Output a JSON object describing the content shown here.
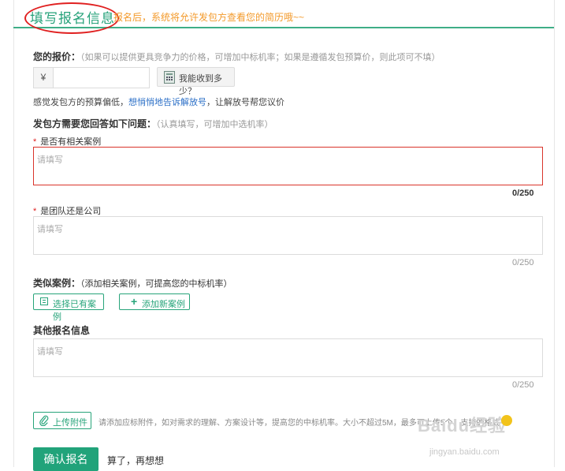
{
  "header": {
    "title": "填写报名信息",
    "notice": "报名后，系统将允许发包方查看您的简历哦~~"
  },
  "price": {
    "label": "您的报价：",
    "hint": "（如果可以提供更具竞争力的价格，可增加中标机率；如果是遵循发包预算价，则此项可不填）",
    "currency": "¥",
    "value": "",
    "calc_button": "我能收到多少？",
    "tip_prefix": "感觉发包方的预算偏低，",
    "tip_link": "想悄悄地告诉解放号",
    "tip_suffix": "，让解放号帮您议价"
  },
  "questions": {
    "label": "发包方需要您回答如下问题：",
    "hint": "（认真填写，可增加中选机率）",
    "items": [
      {
        "required_mark": "*",
        "label": "是否有相关案例",
        "placeholder": "请填写",
        "counter": "0/250"
      },
      {
        "required_mark": "*",
        "label": "是团队还是公司",
        "placeholder": "请填写",
        "counter": "0/250"
      }
    ]
  },
  "cases": {
    "label": "类似案例：",
    "hint": "（添加相关案例，可提高您的中标机率）",
    "select_button": "选择已有案例",
    "add_button": "添加新案例"
  },
  "other": {
    "label": "其他报名信息",
    "placeholder": "请填写",
    "counter": "0/250"
  },
  "attachment": {
    "button": "上传附件",
    "hint": "请添加应标附件，如对需求的理解、方案设计等，提高您的中标机率。大小不超过5M，最多可上传5个，支持的格式"
  },
  "actions": {
    "confirm": "确认报名",
    "cancel": "算了，再想想"
  },
  "watermark": {
    "brand": "Baidu经验",
    "url": "jingyan.baidu.com"
  },
  "colors": {
    "accent": "#21a37a",
    "notice": "#f39a2b",
    "error_border": "#d9342b",
    "link": "#2b6fc7"
  }
}
